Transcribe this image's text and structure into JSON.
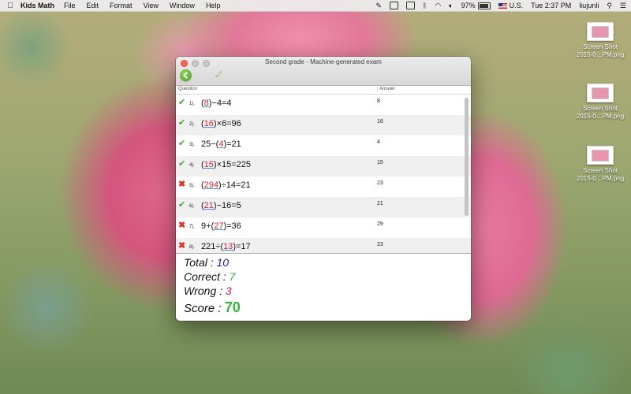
{
  "menubar": {
    "app_name": "Kids Math",
    "menus": [
      "File",
      "Edit",
      "Format",
      "View",
      "Window",
      "Help"
    ],
    "battery": "97%",
    "input_source": "U.S.",
    "clock": "Tue 2:37 PM",
    "user": "liujunli"
  },
  "desktop_icons": [
    {
      "line1": "Screen Shot",
      "line2": "2015-0…PM.png"
    },
    {
      "line1": "Screen Shot",
      "line2": "2015-0…PM.png"
    },
    {
      "line1": "Screen Shot",
      "line2": "2015-0…PM.png"
    }
  ],
  "window": {
    "title": "Second grade - Machine-generated exam",
    "toolbar": {
      "back_icon": "back-arrow-icon",
      "check_icon": "checkmark-icon"
    },
    "columns": {
      "question": "Question",
      "answer": "Answer"
    },
    "rows": [
      {
        "status": "correct",
        "num": "1).",
        "pre": "(",
        "blank": "8",
        "post": ")−4=4",
        "answer": "8"
      },
      {
        "status": "correct",
        "num": "2).",
        "pre": "(",
        "blank": "16",
        "post": ")×6=96",
        "answer": "16"
      },
      {
        "status": "correct",
        "num": "3).",
        "pre": "25−(",
        "blank": "4",
        "post": ")=21",
        "answer": "4"
      },
      {
        "status": "correct",
        "num": "4).",
        "pre": "(",
        "blank": "15",
        "post": ")×15=225",
        "answer": "15"
      },
      {
        "status": "wrong",
        "num": "5).",
        "pre": "(",
        "blank": "294",
        "post": ")÷14=21",
        "answer": "23"
      },
      {
        "status": "correct",
        "num": "6).",
        "pre": "(",
        "blank": "21",
        "post": ")−16=5",
        "answer": "21"
      },
      {
        "status": "wrong",
        "num": "7).",
        "pre": "9+(",
        "blank": "27",
        "post": ")=36",
        "answer": "29"
      },
      {
        "status": "wrong",
        "num": "8).",
        "pre": "221÷(",
        "blank": "13",
        "post": ")=17",
        "answer": "23"
      }
    ],
    "summary": {
      "total_label": "Total :",
      "total": "10",
      "correct_label": "Correct :",
      "correct": "7",
      "wrong_label": "Wrong :",
      "wrong": "3",
      "score_label": "Score :",
      "score": "70"
    }
  },
  "colors": {
    "correct": "#3fa83a",
    "wrong": "#d9342b",
    "total": "#1a1fa6",
    "score": "#2eb83a"
  }
}
